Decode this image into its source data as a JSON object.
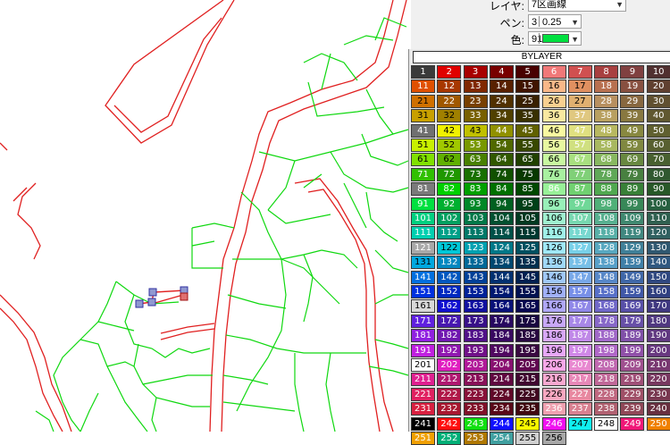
{
  "properties": {
    "layer_label": "レイヤ:",
    "layer_value": "7区画線",
    "pen_label": "ペン:",
    "pen_number": "3",
    "pen_width": "0.25",
    "color_label": "色:",
    "color_value": "91",
    "color_swatch": "#00e040"
  },
  "palette": {
    "header": "BYLAYER",
    "rows": [
      {
        "codes": [
          "1",
          "2",
          "3",
          "4",
          "5",
          "6",
          "7",
          "8",
          "9",
          "10"
        ],
        "colors": [
          "#3a3a3a",
          "#e00000",
          "#a80000",
          "#780000",
          "#480000",
          "#f07878",
          "#d05050",
          "#a84040",
          "#804040",
          "#503030"
        ],
        "text": [
          "#fff",
          "#fff",
          "#fff",
          "#fff",
          "#fff",
          "#fff",
          "#fff",
          "#fff",
          "#fff",
          "#fff"
        ]
      },
      {
        "codes": [
          "11",
          "12",
          "13",
          "14",
          "15",
          "16",
          "17",
          "18",
          "19",
          "20"
        ],
        "colors": [
          "#e05000",
          "#a83800",
          "#802800",
          "#582000",
          "#401400",
          "#f8b888",
          "#e09060",
          "#b87050",
          "#885040",
          "#604030"
        ],
        "text": [
          "#fff",
          "#fff",
          "#fff",
          "#fff",
          "#fff",
          "#000",
          "#000",
          "#fff",
          "#fff",
          "#fff"
        ]
      },
      {
        "codes": [
          "21",
          "22",
          "23",
          "24",
          "25",
          "26",
          "27",
          "28",
          "29",
          "30"
        ],
        "colors": [
          "#d07000",
          "#a05800",
          "#784000",
          "#503000",
          "#382000",
          "#f8d090",
          "#e0b070",
          "#b89060",
          "#886840",
          "#605030"
        ],
        "text": [
          "#000",
          "#fff",
          "#fff",
          "#fff",
          "#fff",
          "#000",
          "#000",
          "#fff",
          "#fff",
          "#fff"
        ]
      },
      {
        "codes": [
          "31",
          "32",
          "33",
          "34",
          "35",
          "36",
          "37",
          "38",
          "39",
          "40"
        ],
        "colors": [
          "#c8a000",
          "#a08000",
          "#786000",
          "#504000",
          "#383000",
          "#f8e8a0",
          "#e0c880",
          "#b8a060",
          "#887840",
          "#605830"
        ],
        "text": [
          "#000",
          "#000",
          "#fff",
          "#fff",
          "#fff",
          "#000",
          "#fff",
          "#fff",
          "#fff",
          "#fff"
        ]
      },
      {
        "codes": [
          "41",
          "42",
          "43",
          "44",
          "45",
          "46",
          "47",
          "48",
          "49",
          "50"
        ],
        "colors": [
          "#707070",
          "#f0f000",
          "#c0c000",
          "#909000",
          "#606000",
          "#f8f8a0",
          "#e0e080",
          "#b8b860",
          "#888840",
          "#606030"
        ],
        "text": [
          "#fff",
          "#000",
          "#000",
          "#fff",
          "#fff",
          "#000",
          "#fff",
          "#fff",
          "#fff",
          "#fff"
        ]
      },
      {
        "codes": [
          "51",
          "52",
          "53",
          "54",
          "55",
          "56",
          "57",
          "58",
          "59",
          "60"
        ],
        "colors": [
          "#c8f000",
          "#a0c800",
          "#789800",
          "#506800",
          "#384800",
          "#e8f8a0",
          "#d0e080",
          "#a8b860",
          "#808840",
          "#586030"
        ],
        "text": [
          "#000",
          "#000",
          "#fff",
          "#fff",
          "#fff",
          "#000",
          "#fff",
          "#fff",
          "#fff",
          "#fff"
        ]
      },
      {
        "codes": [
          "61",
          "62",
          "63",
          "64",
          "65",
          "66",
          "67",
          "68",
          "69",
          "70"
        ],
        "colors": [
          "#80e000",
          "#60b000",
          "#488000",
          "#305800",
          "#204000",
          "#c8f8a0",
          "#a8e080",
          "#88b860",
          "#688840",
          "#486030"
        ],
        "text": [
          "#000",
          "#000",
          "#fff",
          "#fff",
          "#fff",
          "#000",
          "#fff",
          "#fff",
          "#fff",
          "#fff"
        ]
      },
      {
        "codes": [
          "71",
          "72",
          "73",
          "74",
          "75",
          "76",
          "77",
          "78",
          "79",
          "80"
        ],
        "colors": [
          "#30c000",
          "#209800",
          "#187000",
          "#105000",
          "#083800",
          "#a8f0a0",
          "#80d078",
          "#60a858",
          "#488040",
          "#305830"
        ],
        "text": [
          "#fff",
          "#fff",
          "#fff",
          "#fff",
          "#fff",
          "#000",
          "#fff",
          "#fff",
          "#fff",
          "#fff"
        ]
      },
      {
        "codes": [
          "81",
          "82",
          "83",
          "84",
          "85",
          "86",
          "87",
          "88",
          "89",
          "90"
        ],
        "colors": [
          "#7a7a7a",
          "#00d000",
          "#00a000",
          "#007000",
          "#004800",
          "#98f098",
          "#70d070",
          "#50a850",
          "#388038",
          "#285828"
        ],
        "text": [
          "#fff",
          "#fff",
          "#fff",
          "#fff",
          "#fff",
          "#fff",
          "#fff",
          "#fff",
          "#fff",
          "#fff"
        ]
      },
      {
        "codes": [
          "91",
          "92",
          "93",
          "94",
          "95",
          "96",
          "97",
          "98",
          "99",
          "100"
        ],
        "colors": [
          "#00e040",
          "#00b030",
          "#008828",
          "#006020",
          "#004018",
          "#98f0b8",
          "#70d898",
          "#50b078",
          "#388858",
          "#286040"
        ],
        "text": [
          "#fff",
          "#fff",
          "#fff",
          "#fff",
          "#fff",
          "#000",
          "#fff",
          "#fff",
          "#fff",
          "#fff"
        ]
      },
      {
        "codes": [
          "101",
          "102",
          "103",
          "104",
          "105",
          "106",
          "107",
          "108",
          "109",
          "110"
        ],
        "colors": [
          "#00d080",
          "#00a060",
          "#007848",
          "#005030",
          "#003820",
          "#a0f0d0",
          "#78d8b0",
          "#58b090",
          "#408870",
          "#306050"
        ],
        "text": [
          "#fff",
          "#fff",
          "#fff",
          "#fff",
          "#fff",
          "#000",
          "#fff",
          "#fff",
          "#fff",
          "#fff"
        ]
      },
      {
        "codes": [
          "111",
          "112",
          "113",
          "114",
          "115",
          "116",
          "117",
          "118",
          "119",
          "120"
        ],
        "colors": [
          "#00d0b0",
          "#00a088",
          "#007868",
          "#005048",
          "#003830",
          "#a0f0e8",
          "#78d8d0",
          "#58b0a8",
          "#408880",
          "#306060"
        ],
        "text": [
          "#fff",
          "#fff",
          "#fff",
          "#fff",
          "#fff",
          "#000",
          "#fff",
          "#fff",
          "#fff",
          "#fff"
        ]
      },
      {
        "codes": [
          "121",
          "122",
          "123",
          "124",
          "125",
          "126",
          "127",
          "128",
          "129",
          "130"
        ],
        "colors": [
          "#a8a8a8",
          "#00c8d8",
          "#00a0b0",
          "#007888",
          "#005060",
          "#a0e8f8",
          "#78d0e8",
          "#58a8c0",
          "#408098",
          "#305870"
        ],
        "text": [
          "#fff",
          "#000",
          "#fff",
          "#fff",
          "#fff",
          "#000",
          "#fff",
          "#fff",
          "#fff",
          "#fff"
        ]
      },
      {
        "codes": [
          "131",
          "132",
          "133",
          "134",
          "135",
          "136",
          "137",
          "138",
          "139",
          "140"
        ],
        "colors": [
          "#00a8e0",
          "#0088c0",
          "#006898",
          "#004870",
          "#003050",
          "#a0d8f8",
          "#78c0e8",
          "#58a0c8",
          "#4080a8",
          "#305880"
        ],
        "text": [
          "#000",
          "#fff",
          "#fff",
          "#fff",
          "#fff",
          "#000",
          "#fff",
          "#fff",
          "#fff",
          "#fff"
        ]
      },
      {
        "codes": [
          "141",
          "142",
          "143",
          "144",
          "145",
          "146",
          "147",
          "148",
          "149",
          "150"
        ],
        "colors": [
          "#0070e0",
          "#0058c0",
          "#004098",
          "#003070",
          "#002050",
          "#a0c8f8",
          "#78a8e8",
          "#5888c8",
          "#4068a8",
          "#304880"
        ],
        "text": [
          "#fff",
          "#fff",
          "#fff",
          "#fff",
          "#fff",
          "#000",
          "#fff",
          "#fff",
          "#fff",
          "#fff"
        ]
      },
      {
        "codes": [
          "151",
          "152",
          "153",
          "154",
          "155",
          "156",
          "157",
          "158",
          "159",
          "160"
        ],
        "colors": [
          "#0030e0",
          "#0028c0",
          "#002098",
          "#001870",
          "#001050",
          "#a0b0f8",
          "#7890e8",
          "#5870c8",
          "#4058a8",
          "#304080"
        ],
        "text": [
          "#fff",
          "#fff",
          "#fff",
          "#fff",
          "#fff",
          "#000",
          "#fff",
          "#fff",
          "#fff",
          "#fff"
        ]
      },
      {
        "codes": [
          "161",
          "162",
          "163",
          "164",
          "165",
          "166",
          "167",
          "168",
          "169",
          "170"
        ],
        "colors": [
          "#d8d8d8",
          "#1010d0",
          "#1010a0",
          "#081078",
          "#080850",
          "#b0a8f8",
          "#9088e8",
          "#7068c8",
          "#5850a8",
          "#403880"
        ],
        "text": [
          "#000",
          "#fff",
          "#fff",
          "#fff",
          "#fff",
          "#000",
          "#fff",
          "#fff",
          "#fff",
          "#fff"
        ]
      },
      {
        "codes": [
          "171",
          "172",
          "173",
          "174",
          "175",
          "176",
          "177",
          "178",
          "179",
          "180"
        ],
        "colors": [
          "#6020e0",
          "#4818b0",
          "#381088",
          "#280860",
          "#180840",
          "#c8a8f8",
          "#a888e8",
          "#8868c8",
          "#6850a8",
          "#503880"
        ],
        "text": [
          "#fff",
          "#fff",
          "#fff",
          "#fff",
          "#fff",
          "#000",
          "#fff",
          "#fff",
          "#fff",
          "#fff"
        ]
      },
      {
        "codes": [
          "181",
          "182",
          "183",
          "184",
          "185",
          "186",
          "187",
          "188",
          "189",
          "190"
        ],
        "colors": [
          "#9020e0",
          "#7018b0",
          "#501088",
          "#380860",
          "#280840",
          "#d8a8f8",
          "#c088e8",
          "#a068c8",
          "#8050a8",
          "#603880"
        ],
        "text": [
          "#fff",
          "#fff",
          "#fff",
          "#fff",
          "#fff",
          "#000",
          "#fff",
          "#fff",
          "#fff",
          "#fff"
        ]
      },
      {
        "codes": [
          "191",
          "192",
          "193",
          "194",
          "195",
          "196",
          "197",
          "198",
          "199",
          "200"
        ],
        "colors": [
          "#c020e0",
          "#9018b0",
          "#701088",
          "#500860",
          "#380840",
          "#e8a8f8",
          "#d088e8",
          "#b068c8",
          "#9050a8",
          "#683880"
        ],
        "text": [
          "#fff",
          "#fff",
          "#fff",
          "#fff",
          "#fff",
          "#000",
          "#fff",
          "#fff",
          "#fff",
          "#fff"
        ]
      },
      {
        "codes": [
          "201",
          "202",
          "203",
          "204",
          "205",
          "206",
          "207",
          "208",
          "209",
          "210"
        ],
        "colors": [
          "#ffffff",
          "#e020c0",
          "#b01898",
          "#881070",
          "#600850",
          "#f8a8e8",
          "#e888d0",
          "#c068b0",
          "#a05090",
          "#783870"
        ],
        "text": [
          "#000",
          "#fff",
          "#fff",
          "#fff",
          "#fff",
          "#000",
          "#fff",
          "#fff",
          "#fff",
          "#fff"
        ]
      },
      {
        "codes": [
          "211",
          "212",
          "213",
          "214",
          "215",
          "216",
          "217",
          "218",
          "219",
          "220"
        ],
        "colors": [
          "#e02090",
          "#b01870",
          "#881058",
          "#600840",
          "#400830",
          "#f8a8d0",
          "#e888b8",
          "#c06898",
          "#a05078",
          "#783860"
        ],
        "text": [
          "#fff",
          "#fff",
          "#fff",
          "#fff",
          "#fff",
          "#000",
          "#fff",
          "#fff",
          "#fff",
          "#fff"
        ]
      },
      {
        "codes": [
          "221",
          "222",
          "223",
          "224",
          "225",
          "226",
          "227",
          "228",
          "229",
          "230"
        ],
        "colors": [
          "#e02060",
          "#b01848",
          "#881038",
          "#600828",
          "#400820",
          "#f8a8c0",
          "#e888a0",
          "#c06880",
          "#a05068",
          "#783850"
        ],
        "text": [
          "#fff",
          "#fff",
          "#fff",
          "#fff",
          "#fff",
          "#000",
          "#fff",
          "#fff",
          "#fff",
          "#fff"
        ]
      },
      {
        "codes": [
          "231",
          "232",
          "233",
          "234",
          "235",
          "236",
          "237",
          "238",
          "239",
          "240"
        ],
        "colors": [
          "#d82040",
          "#a81830",
          "#801028",
          "#580818",
          "#400810",
          "#f0a0b0",
          "#d88090",
          "#b06070",
          "#904858",
          "#683040"
        ],
        "text": [
          "#fff",
          "#fff",
          "#fff",
          "#fff",
          "#fff",
          "#fff",
          "#fff",
          "#fff",
          "#fff",
          "#fff"
        ]
      },
      {
        "codes": [
          "241",
          "242",
          "243",
          "244",
          "245",
          "246",
          "247",
          "248",
          "249",
          "250"
        ],
        "colors": [
          "#000000",
          "#ff1010",
          "#10e010",
          "#1010ff",
          "#f8f800",
          "#f010f0",
          "#10f0f0",
          "#ffffff",
          "#f01878",
          "#f08000"
        ],
        "text": [
          "#fff",
          "#fff",
          "#fff",
          "#fff",
          "#000",
          "#fff",
          "#000",
          "#000",
          "#fff",
          "#fff"
        ]
      },
      {
        "codes": [
          "251",
          "252",
          "253",
          "254",
          "255",
          "256"
        ],
        "colors": [
          "#f0a000",
          "#00b078",
          "#b07800",
          "#40a0a0",
          "#d0d0d0",
          "#a8a8a8"
        ],
        "text": [
          "#fff",
          "#fff",
          "#fff",
          "#fff",
          "#000",
          "#000"
        ]
      }
    ]
  }
}
